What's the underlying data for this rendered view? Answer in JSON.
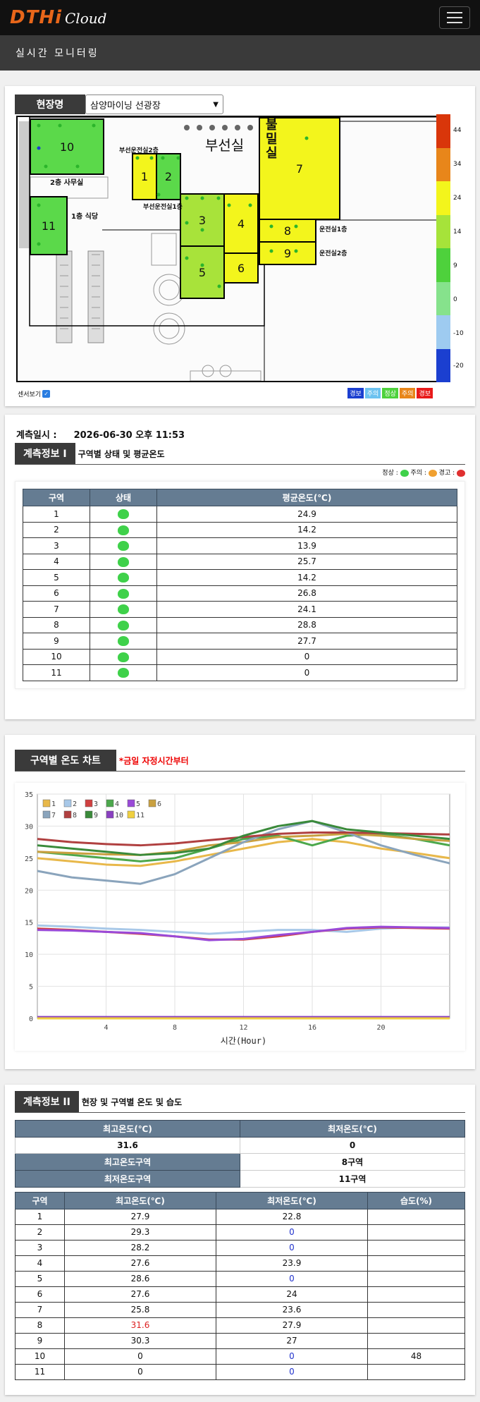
{
  "app": {
    "logo": "DTHi",
    "logo_sub": "Cloud"
  },
  "subtitle": "실시간 모니터링",
  "site": {
    "label": "현장명",
    "selected": "삼양마이닝 선광장"
  },
  "map": {
    "rooms": {
      "busun": "부선실",
      "bulmil": "불밀실"
    },
    "labels": {
      "office2": "2층 사무실",
      "cafe1": "1층 식당",
      "busun2": "부선운전실2층",
      "busun1": "부선운전실1층",
      "unjeon1": "운전실1층",
      "unjeon2": "운전실2층"
    },
    "zones": [
      {
        "id": "10",
        "color": "#5bd94a"
      },
      {
        "id": "11",
        "color": "#5bd94a"
      },
      {
        "id": "1",
        "color": "#f3f51c"
      },
      {
        "id": "2",
        "color": "#5bd94a"
      },
      {
        "id": "3",
        "color": "#a8e33a"
      },
      {
        "id": "4",
        "color": "#f3f51c"
      },
      {
        "id": "5",
        "color": "#a8e33a"
      },
      {
        "id": "6",
        "color": "#f3f51c"
      },
      {
        "id": "7",
        "color": "#f3f51c"
      },
      {
        "id": "8",
        "color": "#f3f51c"
      },
      {
        "id": "9",
        "color": "#f3f51c"
      }
    ],
    "scale": {
      "colors": [
        "#d9360a",
        "#e8861a",
        "#f3f51c",
        "#a6e33a",
        "#4ed13c",
        "#86e28c",
        "#9ecbf0",
        "#1b3fd0"
      ],
      "labels": [
        "44",
        "34",
        "24",
        "14",
        "9",
        "0",
        "-10",
        "-20"
      ]
    },
    "legend": [
      {
        "text": "경보",
        "color": "#1b3fd0"
      },
      {
        "text": "주의",
        "color": "#6cc2f0"
      },
      {
        "text": "정상",
        "color": "#4ed13c"
      },
      {
        "text": "주의",
        "color": "#e8861a"
      },
      {
        "text": "경보",
        "color": "#e81a1a"
      }
    ],
    "sensor_label": "센서보기"
  },
  "measure": {
    "label": "계측일시 :",
    "datetime": "2026-06-30 오후 11:53"
  },
  "section1": {
    "label": "계측정보 I",
    "title": "구역별 상태 및 평균온도",
    "status_legend": "정상 : ",
    "status_legend_mid": " 주의 : ",
    "status_legend_end": " 경고 : ",
    "headers": [
      "구역",
      "상태",
      "평균온도(℃)"
    ],
    "rows": [
      {
        "zone": "1",
        "temp": "24.9"
      },
      {
        "zone": "2",
        "temp": "14.2"
      },
      {
        "zone": "3",
        "temp": "13.9"
      },
      {
        "zone": "4",
        "temp": "25.7"
      },
      {
        "zone": "5",
        "temp": "14.2"
      },
      {
        "zone": "6",
        "temp": "26.8"
      },
      {
        "zone": "7",
        "temp": "24.1"
      },
      {
        "zone": "8",
        "temp": "28.8"
      },
      {
        "zone": "9",
        "temp": "27.7"
      },
      {
        "zone": "10",
        "temp": "0"
      },
      {
        "zone": "11",
        "temp": "0"
      }
    ]
  },
  "section_chart": {
    "label": "구역별 온도 차트",
    "note": "*금일 자정시간부터"
  },
  "chart_data": {
    "type": "line",
    "xlabel": "시간(Hour)",
    "ylabel": "",
    "xlim": [
      0,
      24
    ],
    "ylim": [
      0,
      35
    ],
    "xticks": [
      4,
      8,
      12,
      16,
      20
    ],
    "yticks": [
      0,
      5,
      10,
      15,
      20,
      25,
      30,
      35
    ],
    "grid": true,
    "legend_position": "top-left",
    "x": [
      0,
      2,
      4,
      6,
      8,
      10,
      12,
      14,
      16,
      18,
      20,
      22,
      24
    ],
    "series": [
      {
        "name": "1",
        "color": "#e8b84a",
        "values": [
          25.0,
          24.5,
          24.0,
          23.8,
          24.5,
          25.5,
          26.5,
          27.5,
          28.0,
          27.5,
          26.5,
          25.8,
          25.0
        ]
      },
      {
        "name": "2",
        "color": "#a8c8e8",
        "values": [
          14.5,
          14.3,
          14.0,
          13.8,
          13.5,
          13.2,
          13.5,
          13.8,
          13.8,
          13.5,
          14.0,
          14.2,
          14.2
        ]
      },
      {
        "name": "3",
        "color": "#d04040",
        "values": [
          14.0,
          13.8,
          13.5,
          13.2,
          12.8,
          12.3,
          12.3,
          12.8,
          13.5,
          14.0,
          14.2,
          14.1,
          14.0
        ]
      },
      {
        "name": "4",
        "color": "#4ca84c",
        "values": [
          26.0,
          25.5,
          25.0,
          24.5,
          25.0,
          26.5,
          28.0,
          28.5,
          27.0,
          28.5,
          28.8,
          28.0,
          27.0
        ]
      },
      {
        "name": "5",
        "color": "#9a4ad8",
        "values": [
          13.8,
          13.7,
          13.5,
          13.3,
          12.8,
          12.2,
          12.4,
          13.0,
          13.5,
          14.1,
          14.3,
          14.2,
          14.1
        ]
      },
      {
        "name": "6",
        "color": "#c9a040",
        "values": [
          26.0,
          25.8,
          25.6,
          25.5,
          26.0,
          27.0,
          27.5,
          28.3,
          28.5,
          28.8,
          28.5,
          28.0,
          27.7
        ]
      },
      {
        "name": "7",
        "color": "#8aa4bc",
        "values": [
          23.0,
          22.0,
          21.5,
          21.0,
          22.5,
          25.0,
          27.5,
          29.5,
          30.8,
          29.0,
          27.0,
          25.5,
          24.2
        ]
      },
      {
        "name": "8",
        "color": "#b04040",
        "values": [
          28.0,
          27.5,
          27.2,
          27.0,
          27.3,
          27.8,
          28.3,
          28.8,
          29.0,
          29.0,
          28.9,
          28.8,
          28.7
        ]
      },
      {
        "name": "9",
        "color": "#3a8a3a",
        "values": [
          27.0,
          26.5,
          26.0,
          25.5,
          25.8,
          26.5,
          28.5,
          30.0,
          30.8,
          29.5,
          29.0,
          28.5,
          28.0
        ]
      },
      {
        "name": "10",
        "color": "#8a40c0",
        "values": [
          0.2,
          0.2,
          0.2,
          0.2,
          0.2,
          0.2,
          0.2,
          0.2,
          0.2,
          0.2,
          0.2,
          0.2,
          0.2
        ]
      },
      {
        "name": "11",
        "color": "#f0d040",
        "values": [
          0,
          0,
          0,
          0,
          0,
          0,
          0,
          0,
          0,
          0,
          0,
          0,
          0
        ]
      }
    ]
  },
  "section2": {
    "label": "계측정보 II",
    "title": "현장 및 구역별 온도 및 습도",
    "max_temp_label": "최고온도(℃)",
    "min_temp_label": "최저온도(℃)",
    "max_temp": "31.6",
    "min_temp": "0",
    "max_zone_label": "최고온도구역",
    "max_zone": "8구역",
    "min_zone_label": "최저온도구역",
    "min_zone": "11구역",
    "headers": [
      "구역",
      "최고온도(℃)",
      "최저온도(℃)",
      "습도(%)"
    ],
    "rows": [
      {
        "zone": "1",
        "max": "27.9",
        "min": "22.8",
        "hum": ""
      },
      {
        "zone": "2",
        "max": "29.3",
        "min": "0",
        "hum": ""
      },
      {
        "zone": "3",
        "max": "28.2",
        "min": "0",
        "hum": ""
      },
      {
        "zone": "4",
        "max": "27.6",
        "min": "23.9",
        "hum": ""
      },
      {
        "zone": "5",
        "max": "28.6",
        "min": "0",
        "hum": ""
      },
      {
        "zone": "6",
        "max": "27.6",
        "min": "24",
        "hum": ""
      },
      {
        "zone": "7",
        "max": "25.8",
        "min": "23.6",
        "hum": ""
      },
      {
        "zone": "8",
        "max": "31.6",
        "min": "27.9",
        "hum": ""
      },
      {
        "zone": "9",
        "max": "30.3",
        "min": "27",
        "hum": ""
      },
      {
        "zone": "10",
        "max": "0",
        "min": "0",
        "hum": "48"
      },
      {
        "zone": "11",
        "max": "0",
        "min": "0",
        "hum": ""
      }
    ]
  }
}
